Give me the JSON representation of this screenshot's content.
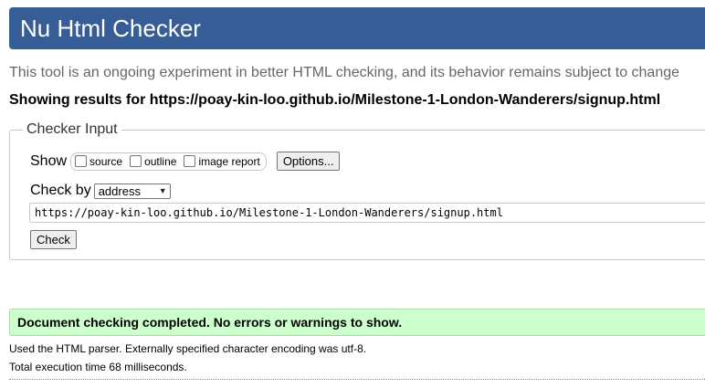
{
  "header": {
    "title": "Nu Html Checker",
    "background_color": "#365d95"
  },
  "tagline": "This tool is an ongoing experiment in better HTML checking, and its behavior remains subject to change",
  "showing": "Showing results for https://poay-kin-loo.github.io/Milestone-1-London-Wanderers/signup.html",
  "checker_input": {
    "legend": "Checker Input",
    "show_label": "Show",
    "show_options": [
      {
        "label": "source",
        "checked": false
      },
      {
        "label": "outline",
        "checked": false
      },
      {
        "label": "image report",
        "checked": false
      }
    ],
    "options_button": "Options...",
    "check_by_label": "Check by",
    "check_by_selected": "address",
    "url_value": "https://poay-kin-loo.github.io/Milestone-1-London-Wanderers/signup.html",
    "check_button": "Check"
  },
  "result": {
    "message": "Document checking completed. No errors or warnings to show.",
    "background_color": "#ccffcc"
  },
  "details": {
    "parser": "Used the HTML parser. Externally specified character encoding was utf-8.",
    "execution_time": "Total execution time 68 milliseconds."
  }
}
